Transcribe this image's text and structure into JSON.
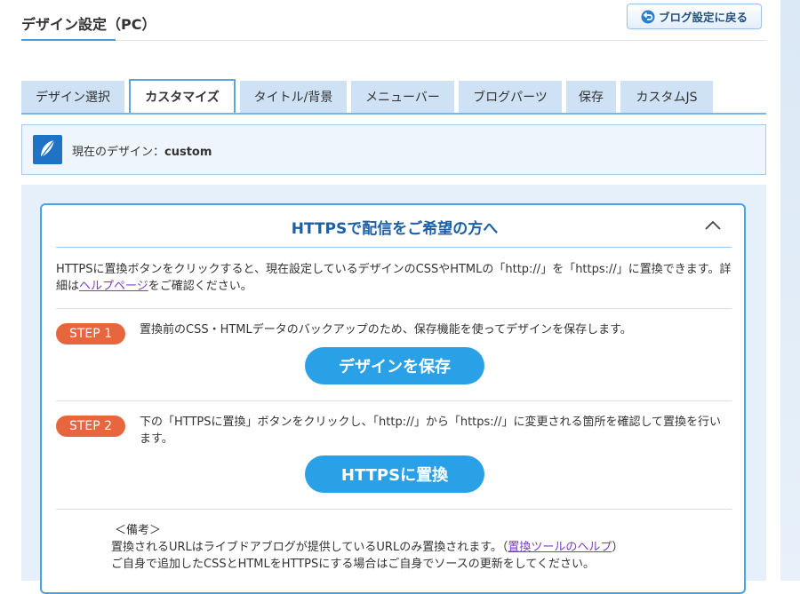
{
  "header": {
    "title": "デザイン設定（PC）",
    "back_button": "ブログ設定に戻る"
  },
  "tabs": [
    {
      "label": "デザイン選択",
      "active": false
    },
    {
      "label": "カスタマイズ",
      "active": true
    },
    {
      "label": "タイトル/背景",
      "active": false
    },
    {
      "label": "メニューバー",
      "active": false
    },
    {
      "label": "ブログパーツ",
      "active": false
    },
    {
      "label": "保存",
      "active": false
    },
    {
      "label": "カスタムJS",
      "active": false
    }
  ],
  "current_design": {
    "label": "現在のデザイン：",
    "value": "custom"
  },
  "https_panel": {
    "title": "HTTPSで配信をご希望の方へ",
    "intro_part1": "HTTPSに置換ボタンをクリックすると、現在設定しているデザインのCSSやHTMLの「http://」を「https://」に置換できます。詳細は",
    "intro_link": "ヘルプページ",
    "intro_part2": "をご確認ください。",
    "step1": {
      "badge": "STEP 1",
      "text": "置換前のCSS・HTMLデータのバックアップのため、保存機能を使ってデザインを保存します。",
      "button": "デザインを保存"
    },
    "step2": {
      "badge": "STEP 2",
      "text": "下の「HTTPSに置換」ボタンをクリックし、「http://」から「https://」に変更される箇所を確認して置換を行います。",
      "button": "HTTPSに置換"
    },
    "note": {
      "heading": "＜備考＞",
      "line1": "置換されるURLはライブドアブログが提供しているURLのみ置換されます。（",
      "line1_link": "置換ツールのヘルプ",
      "line1_end": "）",
      "line2": "ご自身で追加したCSSとHTMLをHTTPSにする場合はご自身でソースの更新をしてください。"
    }
  },
  "colors": {
    "accent_blue": "#2aa0e6",
    "step_orange": "#e8663e",
    "title_blue": "#1a5fa8"
  }
}
